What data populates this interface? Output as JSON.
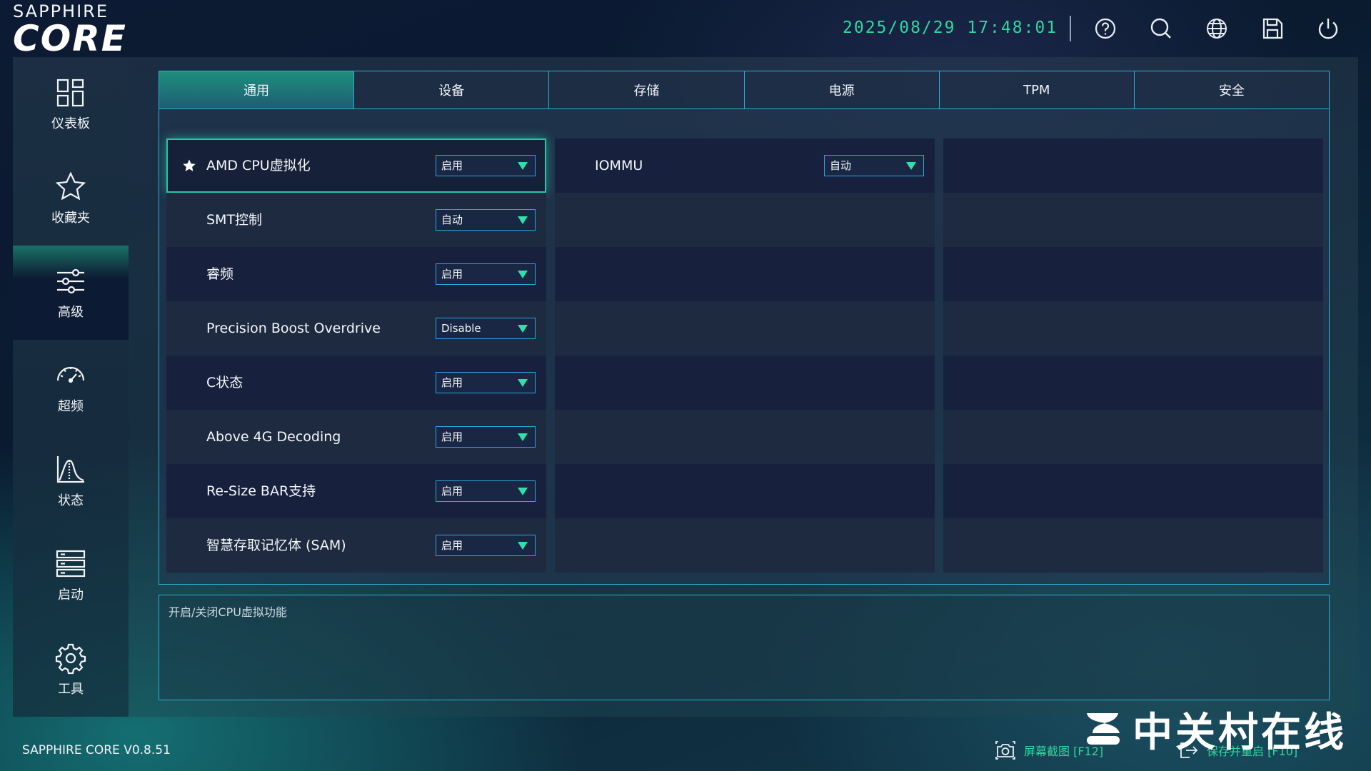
{
  "header": {
    "brand_top": "SAPPHIRE",
    "brand_core": "CORE",
    "datetime": "2025/08/29 17:48:01",
    "icons": [
      "help-icon",
      "search-icon",
      "globe-icon",
      "save-icon",
      "power-icon"
    ]
  },
  "sidebar": {
    "items": [
      {
        "label": "仪表板",
        "icon": "dashboard-icon"
      },
      {
        "label": "收藏夹",
        "icon": "star-icon"
      },
      {
        "label": "高级",
        "icon": "sliders-icon",
        "active": true
      },
      {
        "label": "超频",
        "icon": "gauge-icon"
      },
      {
        "label": "状态",
        "icon": "chart-icon"
      },
      {
        "label": "启动",
        "icon": "list-icon"
      },
      {
        "label": "工具",
        "icon": "gear-icon"
      }
    ]
  },
  "tabs": [
    {
      "label": "通用",
      "active": true
    },
    {
      "label": "设备"
    },
    {
      "label": "存储"
    },
    {
      "label": "电源"
    },
    {
      "label": "TPM"
    },
    {
      "label": "安全"
    }
  ],
  "settings": {
    "column1": [
      {
        "name": "AMD CPU虚拟化",
        "value": "启用",
        "starred": true,
        "selected": true
      },
      {
        "name": "SMT控制",
        "value": "自动"
      },
      {
        "name": "睿频",
        "value": "启用"
      },
      {
        "name": "Precision Boost Overdrive",
        "value": "Disable"
      },
      {
        "name": "C状态",
        "value": "启用"
      },
      {
        "name": "Above 4G Decoding",
        "value": "启用"
      },
      {
        "name": "Re-Size BAR支持",
        "value": "启用"
      },
      {
        "name": "智慧存取记忆体 (SAM)",
        "value": "启用"
      }
    ],
    "column2": [
      {
        "name": "IOMMU",
        "value": "自动"
      }
    ]
  },
  "description": "开启/关闭CPU虚拟功能",
  "footer": {
    "version": "SAPPHIRE CORE V0.8.51",
    "screenshot_label": "屏幕截图 [F12]",
    "save_restart_label": "保存并重启 [F10]"
  },
  "watermark": "中关村在线",
  "colors": {
    "accent": "#2fd6a0",
    "border": "#2ab0d8",
    "row_dark": "#17213e",
    "row_light": "#1e2a40"
  }
}
